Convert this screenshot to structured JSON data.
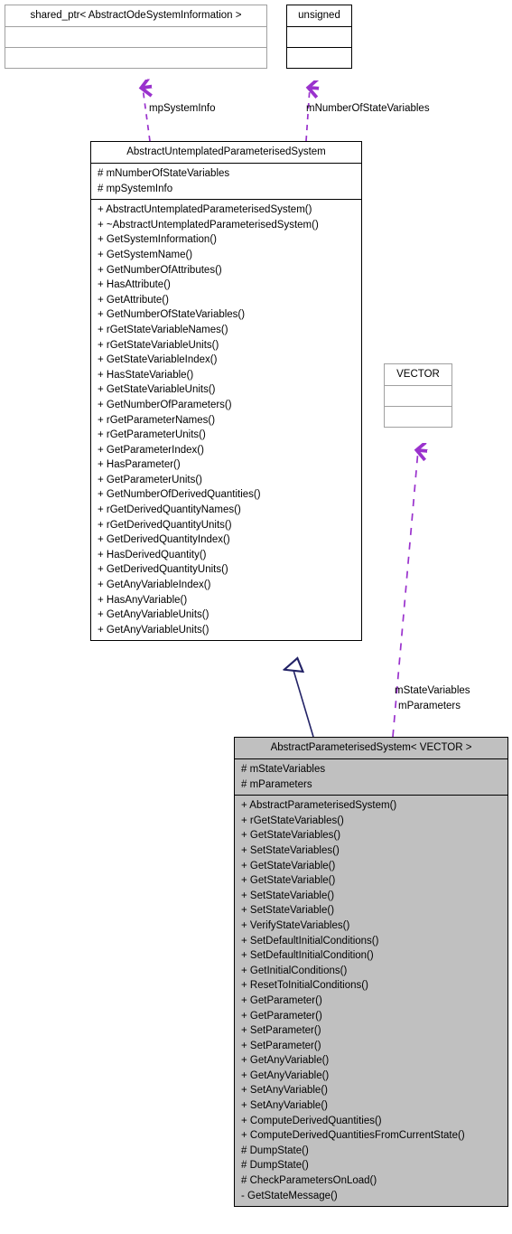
{
  "diagram": {
    "kind": "uml-class-diagram",
    "colors": {
      "dependency_arrow": "#9a32cd",
      "inheritance_arrow": "#222266",
      "filled_box_background": "#c0c0c0",
      "plain_box_border": "#a0a0a0",
      "strong_box_border": "#000000",
      "background": "#ffffff",
      "text": "#000000"
    }
  },
  "boxes": {
    "shared_ptr": {
      "title": "shared_ptr< AbstractOdeSystemInformation >",
      "attributes": [],
      "operations": []
    },
    "unsigned": {
      "title": "unsigned",
      "attributes": [],
      "operations": []
    },
    "vector": {
      "title": "VECTOR",
      "attributes": [],
      "operations": []
    },
    "base_class": {
      "title": "AbstractUntemplatedParameterisedSystem",
      "attributes": [
        "# mNumberOfStateVariables",
        "# mpSystemInfo"
      ],
      "operations": [
        "+ AbstractUntemplatedParameterisedSystem()",
        "+ ~AbstractUntemplatedParameterisedSystem()",
        "+ GetSystemInformation()",
        "+ GetSystemName()",
        "+ GetNumberOfAttributes()",
        "+ HasAttribute()",
        "+ GetAttribute()",
        "+ GetNumberOfStateVariables()",
        "+ rGetStateVariableNames()",
        "+ rGetStateVariableUnits()",
        "+ GetStateVariableIndex()",
        "+ HasStateVariable()",
        "+ GetStateVariableUnits()",
        "+ GetNumberOfParameters()",
        "+ rGetParameterNames()",
        "+ rGetParameterUnits()",
        "+ GetParameterIndex()",
        "+ HasParameter()",
        "+ GetParameterUnits()",
        "+ GetNumberOfDerivedQuantities()",
        "+ rGetDerivedQuantityNames()",
        "+ rGetDerivedQuantityUnits()",
        "+ GetDerivedQuantityIndex()",
        "+ HasDerivedQuantity()",
        "+ GetDerivedQuantityUnits()",
        "+ GetAnyVariableIndex()",
        "+ HasAnyVariable()",
        "+ GetAnyVariableUnits()",
        "+ GetAnyVariableUnits()"
      ]
    },
    "derived_class": {
      "title": "AbstractParameterisedSystem< VECTOR >",
      "attributes": [
        "# mStateVariables",
        "# mParameters"
      ],
      "operations": [
        "+ AbstractParameterisedSystem()",
        "+ rGetStateVariables()",
        "+ GetStateVariables()",
        "+ SetStateVariables()",
        "+ GetStateVariable()",
        "+ GetStateVariable()",
        "+ SetStateVariable()",
        "+ SetStateVariable()",
        "+ VerifyStateVariables()",
        "+ SetDefaultInitialConditions()",
        "+ SetDefaultInitialCondition()",
        "+ GetInitialConditions()",
        "+ ResetToInitialConditions()",
        "+ GetParameter()",
        "+ GetParameter()",
        "+ SetParameter()",
        "+ SetParameter()",
        "+ GetAnyVariable()",
        "+ GetAnyVariable()",
        "+ SetAnyVariable()",
        "+ SetAnyVariable()",
        "+ ComputeDerivedQuantities()",
        "+ ComputeDerivedQuantitiesFromCurrentState()",
        "# DumpState()",
        "# DumpState()",
        "# CheckParametersOnLoad()",
        "- GetStateMessage()"
      ]
    }
  },
  "edges": {
    "mp_system_info_label": "mpSystemInfo",
    "m_number_of_state_variables_label": "mNumberOfStateVariables",
    "m_state_variables_label": "mStateVariables",
    "m_parameters_label": "mParameters"
  }
}
